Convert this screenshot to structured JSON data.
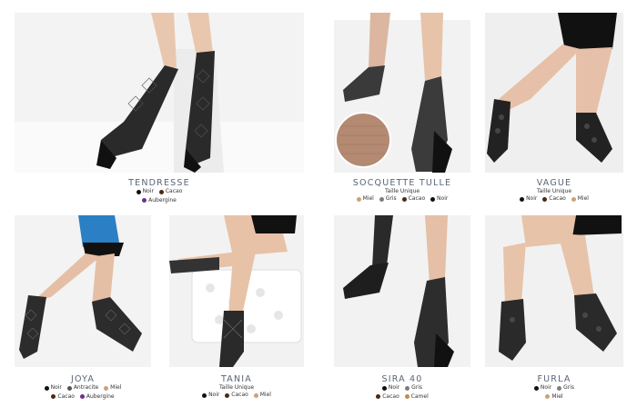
{
  "products": [
    {
      "id": "tendresse",
      "name": "TENDRESSE",
      "subtitle": "",
      "color_rows": [
        [
          {
            "name": "Noir",
            "hex": "#111111"
          },
          {
            "name": "Cacao",
            "hex": "#4a2a14"
          }
        ],
        [
          {
            "name": "Aubergine",
            "hex": "#6b2f8f"
          }
        ]
      ]
    },
    {
      "id": "socquette-tulle",
      "name": "SOCQUETTE TULLE",
      "subtitle": "Taille Unique",
      "color_rows": [
        [
          {
            "name": "Miel",
            "hex": "#c9a27a"
          },
          {
            "name": "Gris",
            "hex": "#7d7d7d"
          },
          {
            "name": "Cacao",
            "hex": "#4a2a14"
          },
          {
            "name": "Noir",
            "hex": "#111111"
          }
        ]
      ]
    },
    {
      "id": "vague",
      "name": "VAGUE",
      "subtitle": "Taille Unique",
      "color_rows": [
        [
          {
            "name": "Noir",
            "hex": "#111111"
          },
          {
            "name": "Cacao",
            "hex": "#4a2a14"
          },
          {
            "name": "Miel",
            "hex": "#c9a27a"
          }
        ]
      ]
    },
    {
      "id": "joya",
      "name": "JOYA",
      "subtitle": "",
      "color_rows": [
        [
          {
            "name": "Noir",
            "hex": "#111111"
          },
          {
            "name": "Antracite",
            "hex": "#555555"
          },
          {
            "name": "Miel",
            "hex": "#c9a27a"
          }
        ],
        [
          {
            "name": "Cacao",
            "hex": "#4a2a14"
          },
          {
            "name": "Aubergine",
            "hex": "#6b2f8f"
          }
        ]
      ]
    },
    {
      "id": "tania",
      "name": "TANIA",
      "subtitle": "Taille Unique",
      "color_rows": [
        [
          {
            "name": "Noir",
            "hex": "#111111"
          },
          {
            "name": "Cacao",
            "hex": "#4a2a14"
          },
          {
            "name": "Miel",
            "hex": "#c9a27a"
          }
        ]
      ]
    },
    {
      "id": "sira-40",
      "name": "SIRA 40",
      "subtitle": "",
      "color_rows": [
        [
          {
            "name": "Noir",
            "hex": "#111111"
          },
          {
            "name": "Gris",
            "hex": "#7d7d7d"
          }
        ],
        [
          {
            "name": "Cacao",
            "hex": "#4a2a14"
          },
          {
            "name": "Camel",
            "hex": "#c08a52"
          }
        ]
      ]
    },
    {
      "id": "furla",
      "name": "FURLA",
      "subtitle": "",
      "color_rows": [
        [
          {
            "name": "Noir",
            "hex": "#111111"
          },
          {
            "name": "Gris",
            "hex": "#7d7d7d"
          }
        ],
        [
          {
            "name": "Miel",
            "hex": "#c9a27a"
          }
        ]
      ]
    }
  ]
}
